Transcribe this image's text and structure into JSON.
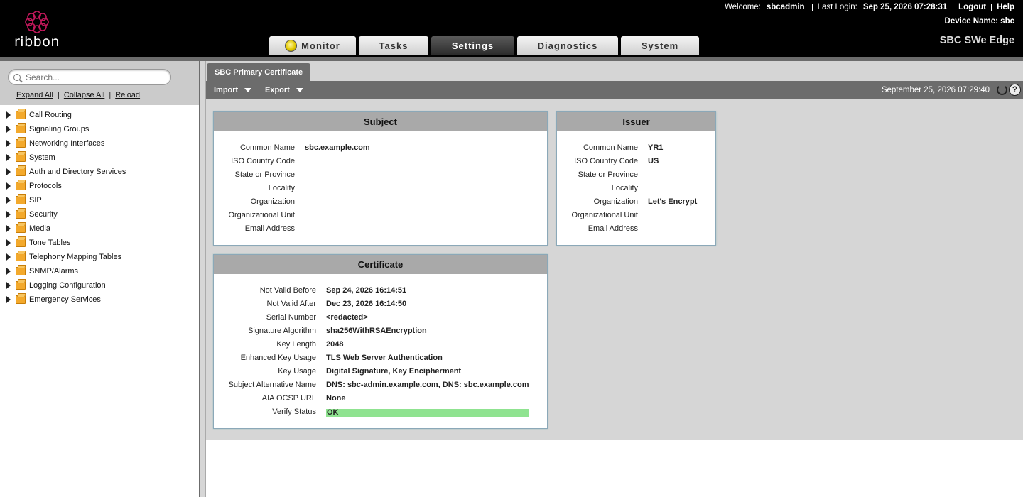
{
  "header": {
    "logo_text": "ribbon",
    "welcome_label": "Welcome:",
    "username": "sbcadmin",
    "last_login_label": "Last Login:",
    "last_login": "Sep 25, 2026 07:28:31",
    "logout": "Logout",
    "help": "Help",
    "device_name_label": "Device Name:",
    "device_name": "sbc",
    "product": "SBC SWe Edge",
    "tabs": [
      {
        "label": "Monitor"
      },
      {
        "label": "Tasks"
      },
      {
        "label": "Settings",
        "active": true
      },
      {
        "label": "Diagnostics"
      },
      {
        "label": "System"
      }
    ]
  },
  "sidebar": {
    "search_placeholder": "Search...",
    "expand_all": "Expand All",
    "collapse_all": "Collapse All",
    "reload": "Reload",
    "items": [
      {
        "label": "Call Routing"
      },
      {
        "label": "Signaling Groups"
      },
      {
        "label": "Networking Interfaces"
      },
      {
        "label": "System"
      },
      {
        "label": "Auth and Directory Services"
      },
      {
        "label": "Protocols"
      },
      {
        "label": "SIP"
      },
      {
        "label": "Security"
      },
      {
        "label": "Media"
      },
      {
        "label": "Tone Tables"
      },
      {
        "label": "Telephony Mapping Tables"
      },
      {
        "label": "SNMP/Alarms"
      },
      {
        "label": "Logging Configuration"
      },
      {
        "label": "Emergency Services"
      }
    ]
  },
  "content": {
    "tab_label": "SBC Primary Certificate",
    "toolbar": {
      "import": "Import",
      "separator": "|",
      "export": "Export",
      "timestamp": "September 25, 2026 07:29:40",
      "help_glyph": "?"
    },
    "subject": {
      "title": "Subject",
      "fields": [
        {
          "label": "Common Name",
          "value": "sbc.example.com"
        },
        {
          "label": "ISO Country Code",
          "value": ""
        },
        {
          "label": "State or Province",
          "value": ""
        },
        {
          "label": "Locality",
          "value": ""
        },
        {
          "label": "Organization",
          "value": ""
        },
        {
          "label": "Organizational Unit",
          "value": ""
        },
        {
          "label": "Email Address",
          "value": ""
        }
      ]
    },
    "issuer": {
      "title": "Issuer",
      "fields": [
        {
          "label": "Common Name",
          "value": "YR1"
        },
        {
          "label": "ISO Country Code",
          "value": "US"
        },
        {
          "label": "State or Province",
          "value": ""
        },
        {
          "label": "Locality",
          "value": ""
        },
        {
          "label": "Organization",
          "value": "Let's Encrypt"
        },
        {
          "label": "Organizational Unit",
          "value": ""
        },
        {
          "label": "Email Address",
          "value": ""
        }
      ]
    },
    "certificate": {
      "title": "Certificate",
      "fields": [
        {
          "label": "Not Valid Before",
          "value": "Sep 24, 2026 16:14:51"
        },
        {
          "label": "Not Valid After",
          "value": "Dec 23, 2026 16:14:50"
        },
        {
          "label": "Serial Number",
          "value": "<redacted>"
        },
        {
          "label": "Signature Algorithm",
          "value": "sha256WithRSAEncryption"
        },
        {
          "label": "Key Length",
          "value": "2048"
        },
        {
          "label": "Enhanced Key Usage",
          "value": "TLS Web Server Authentication"
        },
        {
          "label": "Key Usage",
          "value": "Digital Signature, Key Encipherment"
        },
        {
          "label": "Subject Alternative Name",
          "value": "DNS: sbc-admin.example.com, DNS: sbc.example.com"
        },
        {
          "label": "AIA OCSP URL",
          "value": "None"
        },
        {
          "label": "Verify Status",
          "value": "OK",
          "status_color": "#8fe390"
        }
      ]
    }
  },
  "colors": {
    "header_bg": "#000000",
    "panel_title_bg": "#a9a9a9",
    "verify_ok": "#8fe390",
    "logo_ring": "#c2185b"
  }
}
